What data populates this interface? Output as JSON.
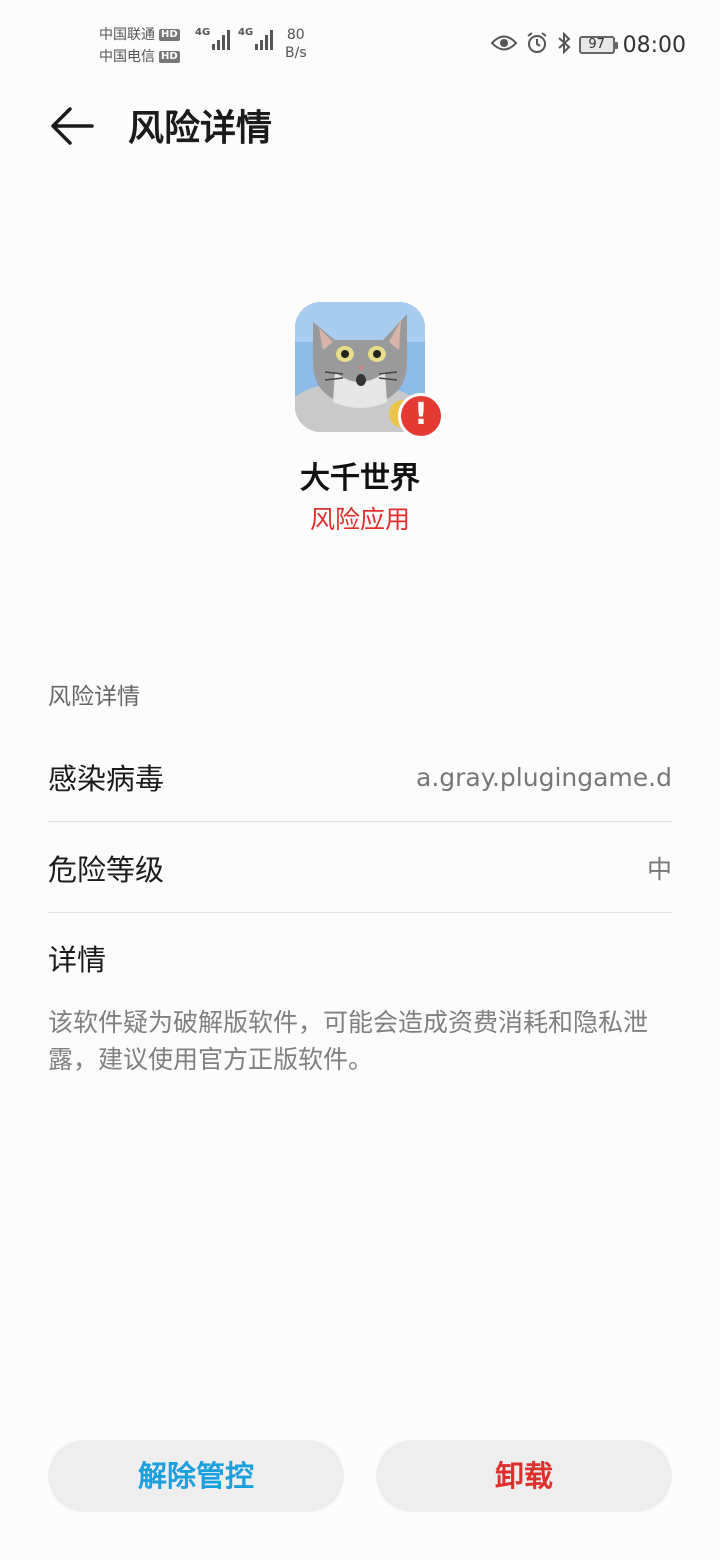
{
  "status_bar": {
    "carrier_1": "中国联通",
    "carrier_2": "中国电信",
    "hd_badge": "HD",
    "network_type": "4G",
    "speed_value": "80",
    "speed_unit": "B/s",
    "battery_level": "97",
    "time": "08:00"
  },
  "header": {
    "title": "风险详情"
  },
  "app": {
    "name": "大千世界",
    "status": "风险应用",
    "badge_glyph": "!",
    "status_color": "#e0302d"
  },
  "details": {
    "section_label": "风险详情",
    "rows": [
      {
        "label": "感染病毒",
        "value": "a.gray.plugingame.d"
      },
      {
        "label": "危险等级",
        "value": "中"
      }
    ],
    "description_title": "详情",
    "description_text": "该软件疑为破解版软件，可能会造成资费消耗和隐私泄露，建议使用官方正版软件。"
  },
  "actions": {
    "release_label": "解除管控",
    "release_color": "#1a9fdf",
    "uninstall_label": "卸载",
    "uninstall_color": "#e0302d"
  }
}
